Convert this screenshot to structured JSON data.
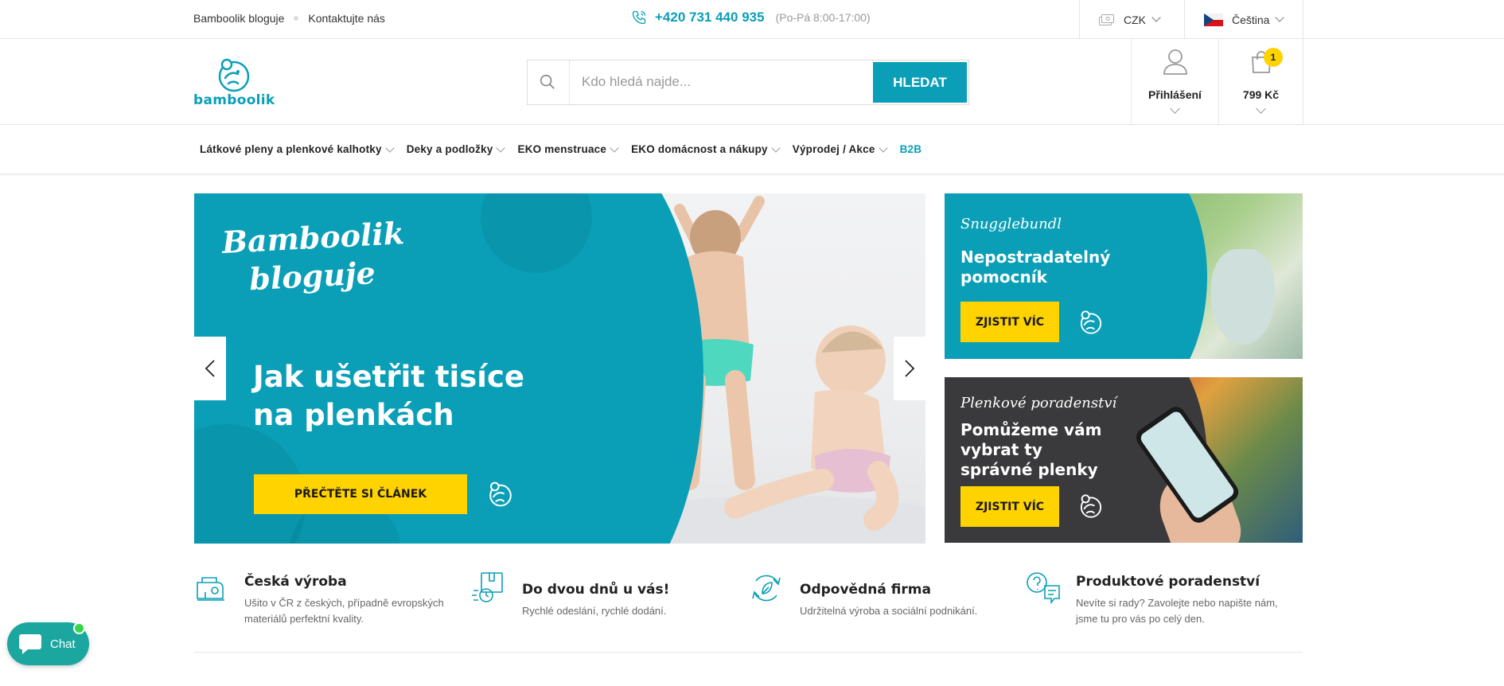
{
  "topbar": {
    "links": [
      "Bamboolik bloguje",
      "Kontaktujte nás"
    ],
    "phone": "+420 731 440 935",
    "hours": "(Po-Pá 8:00-17:00)",
    "currency": "CZK",
    "language": "Čeština"
  },
  "header": {
    "logo_text": "bamboolik",
    "search_placeholder": "Kdo hledá najde...",
    "search_button": "HLEDAT",
    "login_label": "Přihlášení",
    "cart_count": "1",
    "cart_total": "799 Kč"
  },
  "nav": {
    "items": [
      "Látkové pleny a plenkové kalhotky",
      "Deky a podložky",
      "EKO menstruace",
      "EKO domácnost a nákupy",
      "Výprodej / Akce"
    ],
    "b2b": "B2B"
  },
  "hero": {
    "script_line1": "Bamboolik",
    "script_line2": "bloguje",
    "title": "Jak ušetřit tisíce na plenkách",
    "button": "PŘEČTĚTE SI ČLÁNEK"
  },
  "side_banners": [
    {
      "script": "Snugglebundl",
      "title": "Nepostradatelný pomocník",
      "button": "ZJISTIT VÍC"
    },
    {
      "script": "Plenkové poradenství",
      "title": "Pomůžeme vám vybrat ty správné plenky",
      "button": "ZJISTIT VÍC"
    }
  ],
  "features": [
    {
      "icon": "sewing-machine-icon",
      "title": "Česká výroba",
      "desc": "Ušito v ČR z českých, případně evropských materiálů perfektní kvality."
    },
    {
      "icon": "delivery-icon",
      "title": "Do dvou dnů u vás!",
      "desc": "Rychlé odeslání, rychlé dodání."
    },
    {
      "icon": "eco-leaf-icon",
      "title": "Odpovědná firma",
      "desc": "Udržitelná výroba a sociální podnikání."
    },
    {
      "icon": "question-chat-icon",
      "title": "Produktové poradenství",
      "desc": "Nevíte si rady? Zavolejte nebo napište nám, jsme tu pro vás po celý den."
    }
  ],
  "chat": {
    "label": "Chat"
  },
  "colors": {
    "brand": "#0a9fb7",
    "accent": "#ffd300",
    "dark_banner": "#3a3a3c"
  }
}
